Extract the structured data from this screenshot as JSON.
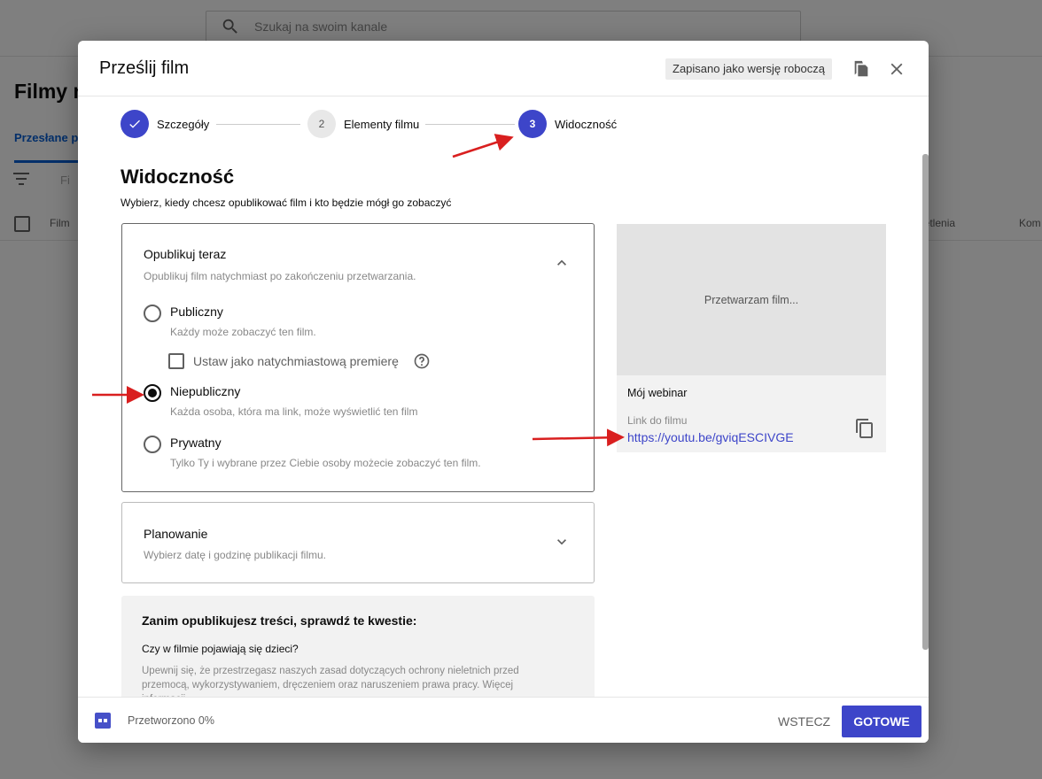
{
  "background": {
    "search_placeholder": "Szukaj na swoim kanale",
    "page_title": "Filmy n",
    "tab_label": "Przesłane pl",
    "filter_text": "Fi",
    "col_film": "Film",
    "col_views": "ietlenia",
    "col_comments": "Kom"
  },
  "dialog": {
    "title": "Prześlij film",
    "draft_badge": "Zapisano jako wersję roboczą",
    "feedback_icon": "feedback-icon",
    "close_icon": "close-icon"
  },
  "stepper": {
    "steps": [
      {
        "label": "Szczegóły",
        "state": "done",
        "number": "1"
      },
      {
        "label": "Elementy filmu",
        "state": "idle",
        "number": "2"
      },
      {
        "label": "Widoczność",
        "state": "active",
        "number": "3"
      }
    ]
  },
  "visibility": {
    "title": "Widoczność",
    "description": "Wybierz, kiedy chcesz opublikować film i kto będzie mógł go zobaczyć",
    "publish_now": {
      "title": "Opublikuj teraz",
      "subtitle": "Opublikuj film natychmiast po zakończeniu przetwarzania.",
      "options": [
        {
          "label": "Publiczny",
          "desc": "Każdy może zobaczyć ten film.",
          "checked": false
        },
        {
          "label": "Niepubliczny",
          "desc": "Każda osoba, która ma link, może wyświetlić ten film",
          "checked": true
        },
        {
          "label": "Prywatny",
          "desc": "Tylko Ty i wybrane przez Ciebie osoby możecie zobaczyć ten film.",
          "checked": false
        }
      ],
      "premiere_label": "Ustaw jako natychmiastową premierę"
    },
    "schedule": {
      "title": "Planowanie",
      "subtitle": "Wybierz datę i godzinę publikacji filmu."
    },
    "checklist": {
      "title": "Zanim opublikujesz treści, sprawdź te kwestie:",
      "question": "Czy w filmie pojawiają się dzieci?",
      "text": "Upewnij się, że przestrzegasz naszych zasad dotyczących ochrony nieletnich przed przemocą, wykorzystywaniem, dręczeniem oraz naruszeniem prawa pracy. Więcej informacji"
    }
  },
  "preview": {
    "processing_text": "Przetwarzam film...",
    "video_name": "Mój webinar",
    "link_label": "Link do filmu",
    "link": "https://youtu.be/gviqESCIVGE"
  },
  "footer": {
    "processed_text": "Przetworzono 0%",
    "back_label": "WSTECZ",
    "done_label": "GOTOWE"
  },
  "colors": {
    "accent": "#3d45c9",
    "arrow": "#d91f1f"
  }
}
